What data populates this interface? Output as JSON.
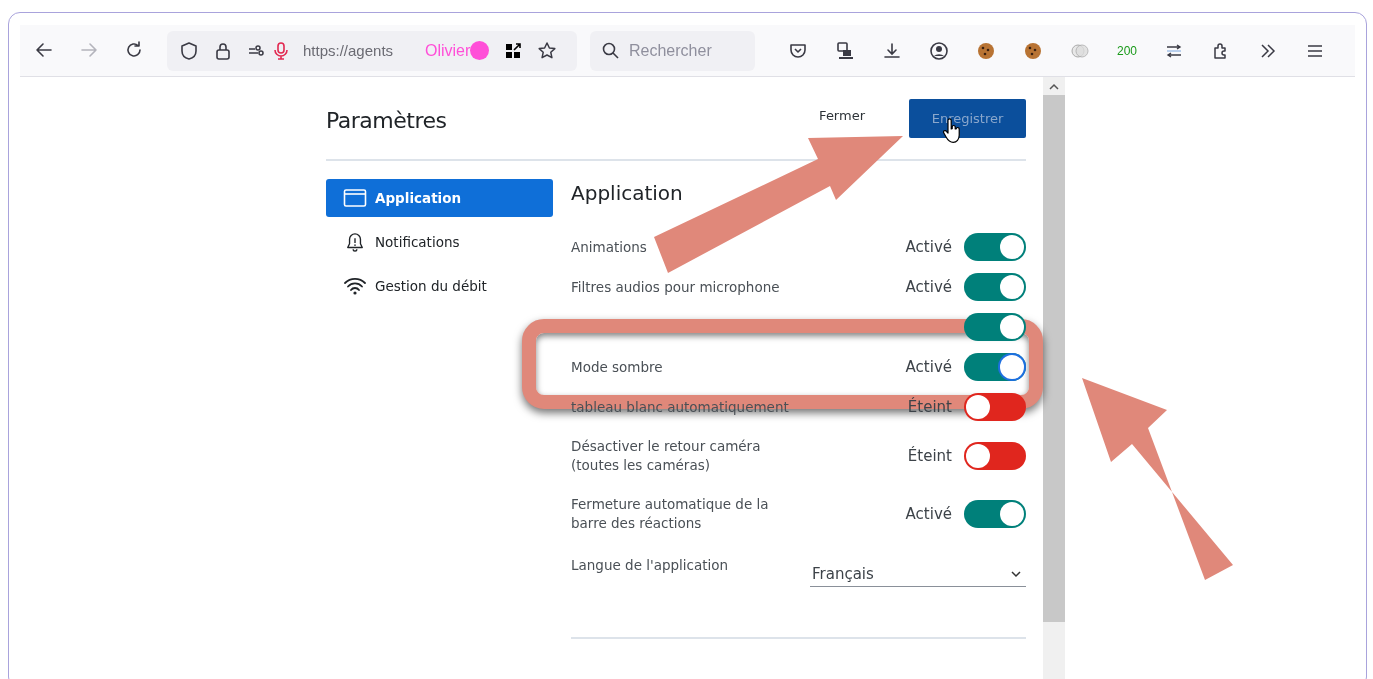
{
  "browser": {
    "nav_buttons": [
      {
        "kind": "back",
        "disabled": false
      },
      {
        "kind": "forward",
        "disabled": true
      },
      {
        "kind": "reload",
        "disabled": false
      }
    ],
    "address_bar": {
      "url": "https://agents",
      "container": "Olivier"
    },
    "search": {
      "placeholder": "Rechercher"
    },
    "toolbar_icons": [
      {
        "kind": "pocket"
      },
      {
        "kind": "device"
      },
      {
        "kind": "download"
      },
      {
        "kind": "account"
      },
      {
        "kind": "cookie"
      },
      {
        "kind": "cookie"
      },
      {
        "kind": "blob"
      },
      {
        "kind": "badge",
        "text": "200"
      },
      {
        "kind": "http"
      },
      {
        "kind": "puzzle"
      },
      {
        "kind": "overflow"
      },
      {
        "kind": "menu"
      }
    ]
  },
  "settings": {
    "title": "Paramètres",
    "close": "Fermer",
    "save": "Enregistrer",
    "sidebar": [
      {
        "label": "Application",
        "selected": true
      },
      {
        "label": "Notifications",
        "selected": false
      },
      {
        "label": "Gestion du débit",
        "selected": false
      }
    ],
    "section_title": "Application",
    "rows": [
      {
        "kind": "toggle",
        "label": "Animations",
        "status": "Activé",
        "on": true,
        "highlighted": false,
        "focused": false
      },
      {
        "kind": "toggle",
        "label": "Filtres audios pour microphone",
        "status": "Activé",
        "on": true,
        "highlighted": false,
        "focused": false
      },
      {
        "kind": "toggle",
        "on": true,
        "highlighted": false,
        "focused": false
      },
      {
        "kind": "toggle",
        "label": "Mode sombre",
        "status": "Activé",
        "on": true,
        "highlighted": true,
        "focused": true
      },
      {
        "kind": "toggle",
        "label": "tableau blanc automatiquement",
        "status": "Éteint",
        "on": false,
        "highlighted": false,
        "focused": false
      },
      {
        "kind": "toggle",
        "label": "Désactiver le retour caméra\n(toutes les caméras)",
        "status": "Éteint",
        "on": false,
        "highlighted": false,
        "focused": false
      },
      {
        "kind": "toggle",
        "label": "Fermeture automatique de la\nbarre des réactions",
        "status": "Activé",
        "on": true,
        "highlighted": false,
        "focused": false
      },
      {
        "kind": "select",
        "label": "Langue de l'application",
        "value": "Français"
      }
    ]
  }
}
